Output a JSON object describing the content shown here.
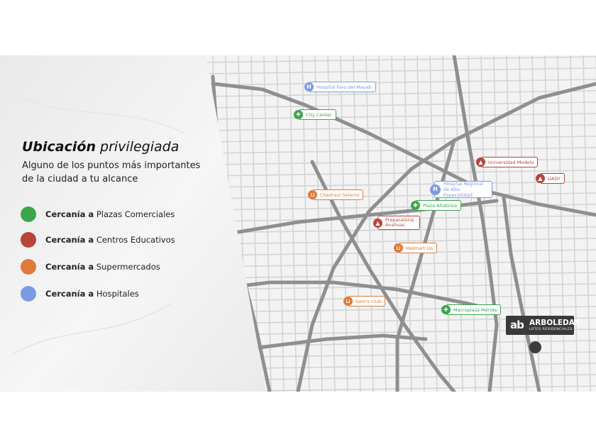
{
  "title": {
    "bold": "Ubicación",
    "rest": "privilegiada"
  },
  "subtitle_lines": [
    "Alguno de los puntos más importantes",
    "de la ciudad a tu alcance"
  ],
  "legend": [
    {
      "bold": "Cercanía a",
      "label": "Plazas Comerciales",
      "color": "#3aa54a"
    },
    {
      "bold": "Cercanía a",
      "label": "Centros Educativos",
      "color": "#b9443a"
    },
    {
      "bold": "Cercanía a",
      "label": "Supermercados",
      "color": "#e07a3c"
    },
    {
      "bold": "Cercanía a",
      "label": "Hospitales",
      "color": "#7b9ae6"
    }
  ],
  "pois": [
    {
      "label": "Hospital Faro del Mayab",
      "category": "hospital",
      "icon": "hospital-icon"
    },
    {
      "label": "City Center",
      "category": "plaza",
      "icon": "gift-icon"
    },
    {
      "label": "Universidad Modelo",
      "category": "educativo",
      "icon": "graduation-cap-icon"
    },
    {
      "label": "UADY",
      "category": "educativo",
      "icon": "graduation-cap-icon"
    },
    {
      "label": "Hospital Regional de Alta Especialidad",
      "category": "hospital",
      "icon": "hospital-icon"
    },
    {
      "label": "Plaza Altabrisa",
      "category": "plaza",
      "icon": "gift-icon"
    },
    {
      "label": "Chedraui Selecto",
      "category": "supermercado",
      "icon": "cart-icon"
    },
    {
      "label": "Preparatoria Anahuac",
      "category": "educativo",
      "icon": "graduation-cap-icon"
    },
    {
      "label": "Walmart Up",
      "category": "supermercado",
      "icon": "cart-icon"
    },
    {
      "label": "Sam's Club",
      "category": "supermercado",
      "icon": "cart-icon"
    },
    {
      "label": "Macroplaza Mérida",
      "category": "plaza",
      "icon": "gift-icon"
    }
  ],
  "brand": {
    "name": "ARBOLEDAS",
    "tagline": "LOTES RESIDENCIALES",
    "logo_mark": "ab"
  }
}
